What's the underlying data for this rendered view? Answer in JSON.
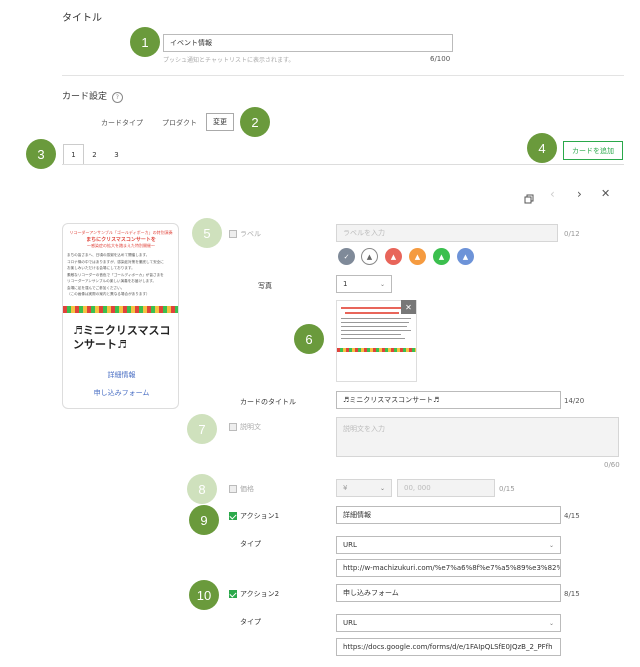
{
  "title_section": {
    "heading": "タイトル",
    "value": "イベント情報",
    "hint": "プッシュ通知とチャットリストに表示されます。",
    "count": "6/100"
  },
  "card_settings": {
    "heading": "カード設定",
    "type_label": "カードタイプ",
    "type_value": "プロダクト",
    "change_button": "変更"
  },
  "card_tabs": [
    "1",
    "2",
    "3"
  ],
  "add_card_button": "カードを追加",
  "badges": [
    "1",
    "2",
    "3",
    "4",
    "5",
    "6",
    "7",
    "8",
    "9",
    "10"
  ],
  "toolbar": {
    "copy_icon": "copy-icon",
    "prev_icon": "chevron-left-icon",
    "next_icon": "chevron-right-icon",
    "close_icon": "close-icon"
  },
  "preview": {
    "banner_lines": [
      "リコーダーアンサンブル「ゴールディポーカ」の特別演奏",
      "まちにクリスマスコンサートを",
      "〜感染症の拡大を踏まえた特別開催〜"
    ],
    "body_lines": [
      "まちの皆さまへ、日頃の感謝を込めて開催します。",
      "コロナ禍の中ではありますが、感染症対策を徹底して安全に",
      "お楽しみいただける会場にしております。",
      "素敵なリコーダーの音色で「ゴールディポーカ」が皆さまを",
      "リコーダーアンサンブルの楽しい演奏をお届けします。",
      "会場に足を運んでご参加ください。",
      "（この画像は実際の案内と異なる場合があります）"
    ],
    "title": "♬ミニクリスマスコンサート♬",
    "action1": "詳細情報",
    "action2": "申し込みフォーム"
  },
  "form": {
    "label_label": "ラベル",
    "label_placeholder": "ラベルを入力",
    "label_count": "0/12",
    "label_colors": [
      "#7f8a99",
      "#ffffff",
      "#e8655a",
      "#f59b40",
      "#3bbf4e",
      "#6d93d8"
    ],
    "photo_label": "写真",
    "photo_select": "1",
    "card_title_label": "カードのタイトル",
    "card_title_value": "♬ミニクリスマスコンサート♬",
    "card_title_count": "14/20",
    "desc_label": "説明文",
    "desc_placeholder": "説明文を入力",
    "desc_count": "0/60",
    "price_label": "価格",
    "price_currency": "¥",
    "price_placeholder": "00, 000",
    "price_count": "0/15",
    "action1_label": "アクション1",
    "action1_value": "詳細情報",
    "action1_count": "4/15",
    "type_label": "タイプ",
    "action1_type": "URL",
    "action1_url": "http://w-machizukuri.com/%e7%a6%8f%e7%a5%89%e3%82%92",
    "action2_label": "アクション2",
    "action2_value": "申し込みフォーム",
    "action2_count": "8/15",
    "action2_type": "URL",
    "action2_url": "https://docs.google.com/forms/d/e/1FAIpQLSfE0JQzB_2_PFfh"
  },
  "colors": {
    "accent": "#2aa84a",
    "badge": "#6a9a3c",
    "badge_light": "#cfe1bd",
    "banner_red": "#e0433a"
  }
}
